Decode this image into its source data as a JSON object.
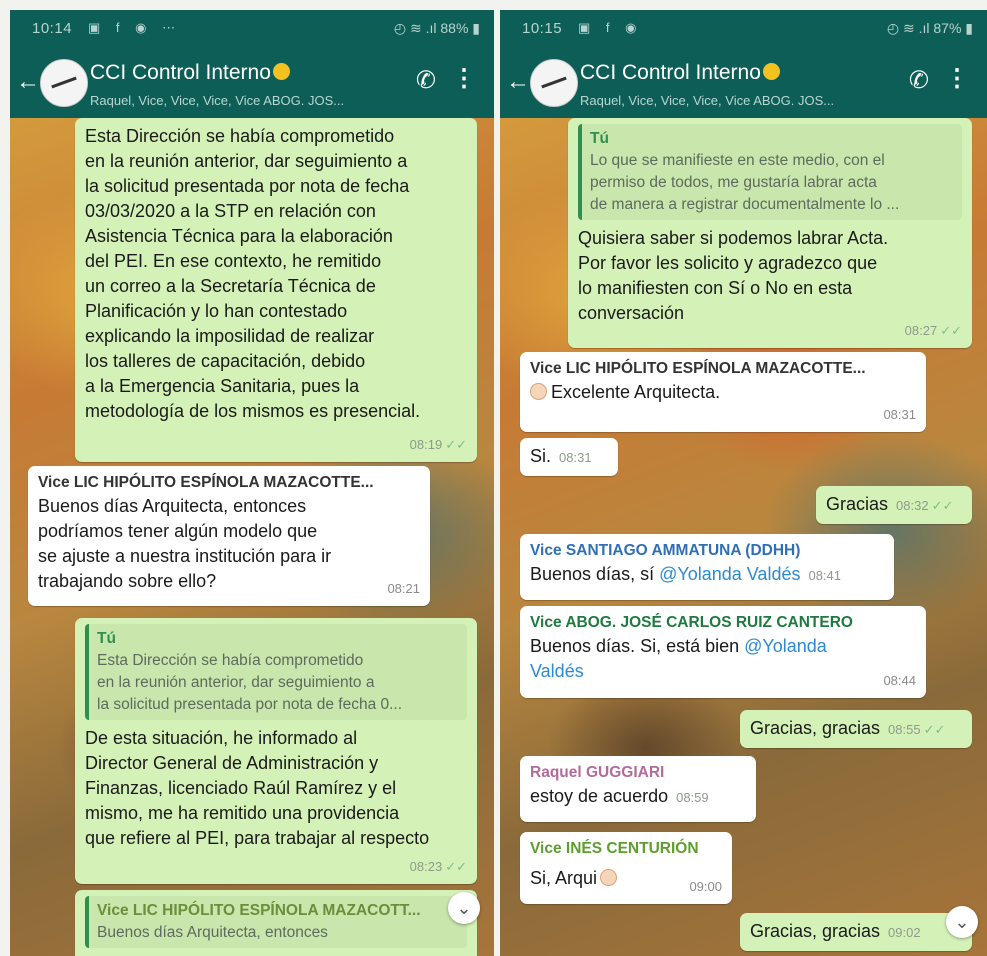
{
  "left": {
    "status": {
      "time": "10:14",
      "icons": "▣ f ◉ ⋯",
      "right": "◴ ≋ .ıl 88% ▮"
    },
    "header": {
      "title": "CCI Control Interno",
      "subtitle": "Raquel, Vice, Vice, Vice, Vice ABOG. JOS..."
    },
    "messages": [
      {
        "text": "Esta Dirección se había comprometido\nen la reunión anterior,  dar seguimiento a\nla solicitud presentada por nota de fecha\n03/03/2020 a la STP en relación con\nAsistencia Técnica para la elaboración\ndel PEI. En ese contexto, he remitido\nun correo a la Secretaría Técnica de\nPlanificación y lo han contestado\nexplicando la imposilidad de realizar\nlos talleres de capacitación, debido\na la Emergencia Sanitaria, pues la\nmetodología de los mismos es presencial.",
        "time": "08:19"
      },
      {
        "sender": "Vice LIC HIPÓLITO ESPÍNOLA MAZACOTTE...",
        "text": "Buenos días  Arquitecta, entonces\npodríamos tener algún modelo que\nse ajuste a nuestra institución para ir\ntrabajando sobre ello?",
        "time": "08:21"
      },
      {
        "quote_name": "Tú",
        "quote_text": "Esta Dirección se había comprometido\nen la reunión anterior,  dar seguimiento a\nla solicitud presentada por nota de fecha 0...",
        "text": "De esta situación, he informado al\nDirector General de Administración y\nFinanzas, licenciado Raúl Ramírez y el\nmismo, me ha remitido una providencia\nque refiere al PEI, para trabajar al respecto",
        "time": "08:23"
      },
      {
        "quote_name": "Vice LIC HIPÓLITO ESPÍNOLA MAZACOTT...",
        "quote_text": "Buenos días  Arquitecta, entonces"
      }
    ]
  },
  "right": {
    "status": {
      "time": "10:15",
      "icons": "▣ f ◉",
      "right": "◴ ≋ .ıl 87% ▮"
    },
    "header": {
      "title": "CCI Control Interno",
      "subtitle": "Raquel, Vice, Vice, Vice, Vice ABOG. JOS..."
    },
    "messages": [
      {
        "quote_name": "Tú",
        "quote_text": "Lo que se manifieste en este medio, con el\npermiso de todos, me gustaría labrar acta\nde manera a registrar documentalmente lo ...",
        "text": "Quisiera saber si podemos labrar Acta.\nPor favor les solicito y agradezco que\nlo manifiesten con Sí o No en esta\nconversación",
        "time": "08:27"
      },
      {
        "sender": "Vice LIC HIPÓLITO ESPÍNOLA MAZACOTTE...",
        "text": "Excelente Arquitecta.",
        "time": "08:31"
      },
      {
        "text": "Si.",
        "time": "08:31"
      },
      {
        "text": "Gracias",
        "time": "08:32"
      },
      {
        "sender": "Vice SANTIAGO AMMATUNA (DDHH)",
        "text_pre": "Buenos días, sí ",
        "mention": "@Yolanda Valdés",
        "time": "08:41"
      },
      {
        "sender": "Vice ABOG. JOSÉ CARLOS RUIZ CANTERO",
        "text_pre": "Buenos días. Si, está bien ",
        "mention": "@Yolanda Valdés",
        "time": "08:44"
      },
      {
        "text": "Gracias, gracias",
        "time": "08:55"
      },
      {
        "sender": "Raquel GUGGIARI",
        "text": "estoy de acuerdo",
        "time": "08:59"
      },
      {
        "sender": "Vice INÉS CENTURIÓN",
        "text": "Si, Arqui",
        "time": "09:00"
      },
      {
        "text": "Gracias, gracias",
        "time": "09:02"
      }
    ]
  },
  "colors": {
    "header": "#0d5e56",
    "outgoing_bubble": "#d4f2b8",
    "incoming_bubble": "#ffffff",
    "sender_hipolito": "#333333",
    "sender_santiago": "#2f6fb8",
    "sender_jose": "#1f7a40",
    "sender_raquel": "#b56a9c",
    "sender_ines": "#5e9e2e",
    "mention": "#2a8ad6"
  },
  "icons": [
    "back-arrow-icon",
    "group-avatar-icon",
    "add-call-icon",
    "more-vert-icon",
    "double-check-icon",
    "scroll-down-icon",
    "ok-hand-emoji",
    "face-emoji"
  ]
}
